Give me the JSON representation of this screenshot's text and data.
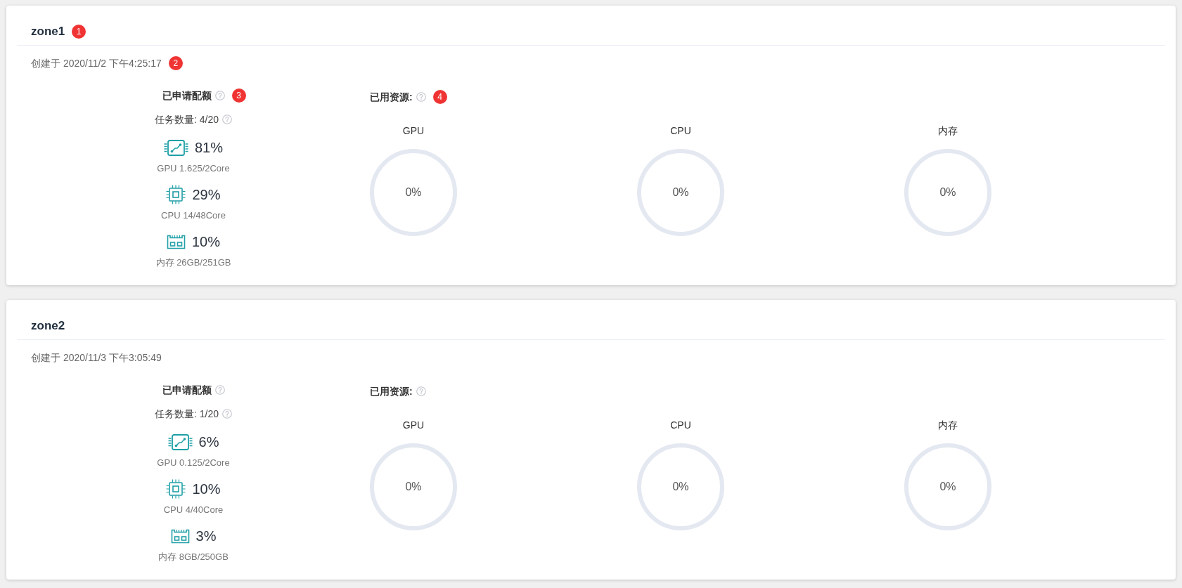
{
  "zones": [
    {
      "title": "zone1",
      "title_marker": "1",
      "created": "创建于 2020/11/2 下午4:25:17",
      "created_marker": "2",
      "quota": {
        "heading": "已申请配额",
        "heading_marker": "3",
        "task_count": "任务数量: 4/20",
        "items": [
          {
            "kind": "gpu",
            "percent": "81%",
            "detail": "GPU 1.625/2Core"
          },
          {
            "kind": "cpu",
            "percent": "29%",
            "detail": "CPU 14/48Core"
          },
          {
            "kind": "memory",
            "percent": "10%",
            "detail": "内存 26GB/251GB"
          }
        ]
      },
      "usage": {
        "heading": "已用资源:",
        "heading_marker": "4",
        "meters": [
          {
            "label": "GPU",
            "reading": "0%"
          },
          {
            "label": "CPU",
            "reading": "0%"
          },
          {
            "label": "内存",
            "reading": "0%"
          }
        ]
      }
    },
    {
      "title": "zone2",
      "created": "创建于 2020/11/3 下午3:05:49",
      "quota": {
        "heading": "已申请配额",
        "task_count": "任务数量: 1/20",
        "items": [
          {
            "kind": "gpu",
            "percent": "6%",
            "detail": "GPU 0.125/2Core"
          },
          {
            "kind": "cpu",
            "percent": "10%",
            "detail": "CPU 4/40Core"
          },
          {
            "kind": "memory",
            "percent": "3%",
            "detail": "内存 8GB/250GB"
          }
        ]
      },
      "usage": {
        "heading": "已用资源:",
        "meters": [
          {
            "label": "GPU",
            "reading": "0%"
          },
          {
            "label": "CPU",
            "reading": "0%"
          },
          {
            "label": "内存",
            "reading": "0%"
          }
        ]
      }
    }
  ]
}
